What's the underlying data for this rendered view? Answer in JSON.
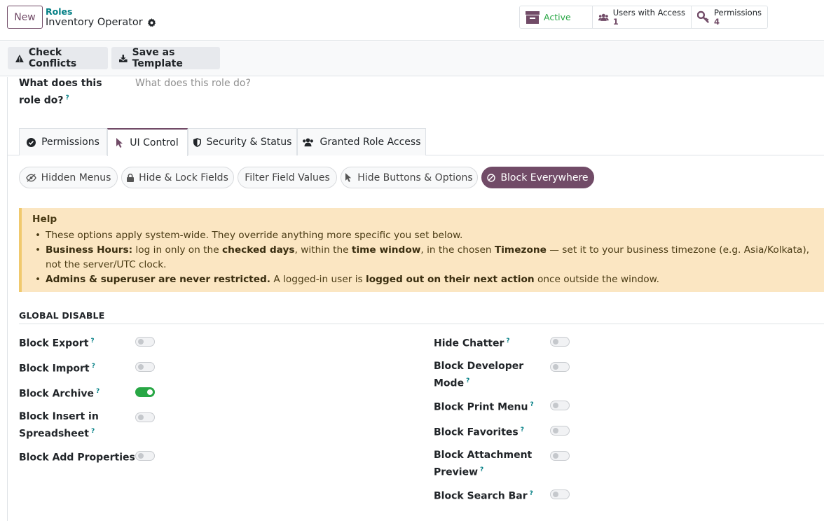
{
  "header": {
    "new_label": "New",
    "breadcrumb_parent": "Roles",
    "record_name": "Inventory Operator"
  },
  "stats": {
    "active_label": "Active",
    "users_label": "Users with Access",
    "users_count": "1",
    "perms_label": "Permissions",
    "perms_count": "4"
  },
  "actions": {
    "check_conflicts": "Check Conflicts",
    "save_template": "Save as Template"
  },
  "description": {
    "label": "What does this role do?",
    "placeholder": "What does this role do?",
    "help": "?"
  },
  "tabs": [
    {
      "label": "Permissions",
      "icon": "check-circle-icon"
    },
    {
      "label": "UI Control",
      "icon": "pointer-icon",
      "active": true
    },
    {
      "label": "Security & Status",
      "icon": "shield-icon"
    },
    {
      "label": "Granted Role Access",
      "icon": "users-icon"
    }
  ],
  "subtabs": [
    {
      "label": "Hidden Menus",
      "icon": "eye-slash-icon"
    },
    {
      "label": "Hide & Lock Fields",
      "icon": "lock-icon"
    },
    {
      "label": "Filter Field Values",
      "icon": ""
    },
    {
      "label": "Hide Buttons & Options",
      "icon": "pointer-icon"
    },
    {
      "label": "Block Everywhere",
      "icon": "ban-icon",
      "active": true
    }
  ],
  "help": {
    "title": "Help",
    "b1": "These options apply system-wide. They override anything more specific you set below.",
    "b2_1": "Business Hours:",
    "b2_2": " log in only on the ",
    "b2_3": "checked days",
    "b2_4": ", within the ",
    "b2_5": "time window",
    "b2_6": ", in the chosen ",
    "b2_7": "Timezone",
    "b2_8": " — set it to your business timezone (e.g. Asia/Kolkata), not the server/UTC clock.",
    "b3_1": "Admins & superuser are never restricted.",
    "b3_2": " A logged-in user is ",
    "b3_3": "logged out on their next action",
    "b3_4": " once outside the window."
  },
  "section": {
    "title": "GLOBAL DISABLE"
  },
  "left_fields": [
    {
      "label_1": "Block Export",
      "label_2": "",
      "on": false
    },
    {
      "label_1": "Block Import",
      "label_2": "",
      "on": false
    },
    {
      "label_1": "Block Archive",
      "label_2": "",
      "on": true
    },
    {
      "label_1": "Block Insert in",
      "label_2": "Spreadsheet",
      "on": false
    },
    {
      "label_1": "Block Add Properties",
      "label_2": "",
      "on": false
    }
  ],
  "right_fields": [
    {
      "label_1": "Hide Chatter",
      "label_2": "",
      "on": false
    },
    {
      "label_1": "Block Developer",
      "label_2": "Mode",
      "on": false
    },
    {
      "label_1": "Block Print Menu",
      "label_2": "",
      "on": false
    },
    {
      "label_1": "Block Favorites",
      "label_2": "",
      "on": false
    },
    {
      "label_1": "Block Attachment",
      "label_2": "Preview",
      "on": false
    },
    {
      "label_1": "Block Search Bar",
      "label_2": "",
      "on": false
    }
  ],
  "colors": {
    "brand": "#714b67",
    "accent_teal": "#017e84",
    "toggle_on": "#28a745",
    "help_bg": "#fbe6c2"
  }
}
